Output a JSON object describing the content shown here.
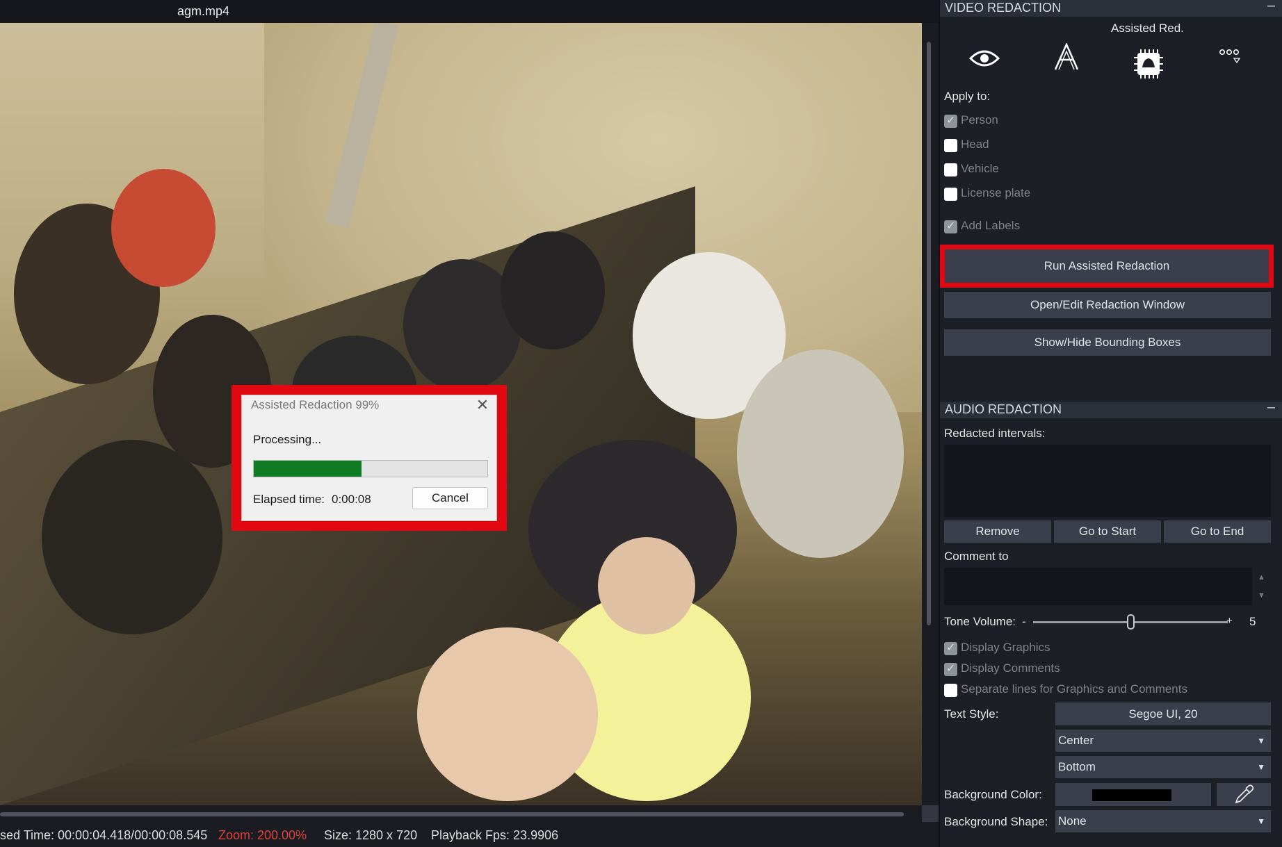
{
  "file": {
    "title": "agm.mp4"
  },
  "status_bar": {
    "elapsed": "sed Time: 00:00:04.418/00:00:08.545",
    "zoom": "Zoom: 200.00%",
    "size": "Size: 1280 x 720",
    "fps": "Playback Fps: 23.9906"
  },
  "dialog": {
    "title": "Assisted Redaction 99%",
    "status": "Processing...",
    "progress_fraction": 0.46,
    "elapsed_label": "Elapsed time:",
    "elapsed_value": "0:00:08",
    "cancel_label": "Cancel"
  },
  "video_redaction": {
    "header": "VIDEO REDACTION",
    "tools": {
      "active_label": "Assisted Red.",
      "icons": [
        "eye-icon",
        "text-a-icon",
        "assisted-redaction-chip-icon",
        "more-options-icon"
      ]
    },
    "apply_to_label": "Apply to:",
    "apply_to": [
      {
        "label": "Person",
        "checked": true
      },
      {
        "label": "Head",
        "checked": false
      },
      {
        "label": "Vehicle",
        "checked": false
      },
      {
        "label": "License plate",
        "checked": false
      }
    ],
    "add_labels": {
      "label": "Add Labels",
      "checked": true
    },
    "run_label": "Run Assisted Redaction",
    "open_edit_label": "Open/Edit Redaction Window",
    "show_hide_label": "Show/Hide Bounding Boxes"
  },
  "audio_redaction": {
    "header": "AUDIO REDACTION",
    "intervals_label": "Redacted intervals:",
    "remove_label": "Remove",
    "go_start_label": "Go to Start",
    "go_end_label": "Go to End",
    "comment_label": "Comment to",
    "tone_volume_label": "Tone Volume:",
    "tone_minus": "-",
    "tone_plus": "+",
    "tone_volume_value": "5",
    "tone_volume_fraction": 0.5,
    "display_graphics": {
      "label": "Display Graphics",
      "checked": true
    },
    "display_comments": {
      "label": "Display Comments",
      "checked": true
    },
    "separate_lines": {
      "label": "Separate lines for Graphics and Comments",
      "checked": false
    },
    "text_style_label": "Text Style:",
    "text_style_value": "Segoe UI, 20",
    "halign_value": "Center",
    "valign_value": "Bottom",
    "background_color_label": "Background Color:",
    "background_color": "#000000",
    "background_shape_label": "Background Shape:",
    "background_shape_value": "None"
  },
  "colors": {
    "highlight": "#e10812",
    "progress": "#0f7b22",
    "zoom_text": "#e0403a"
  }
}
